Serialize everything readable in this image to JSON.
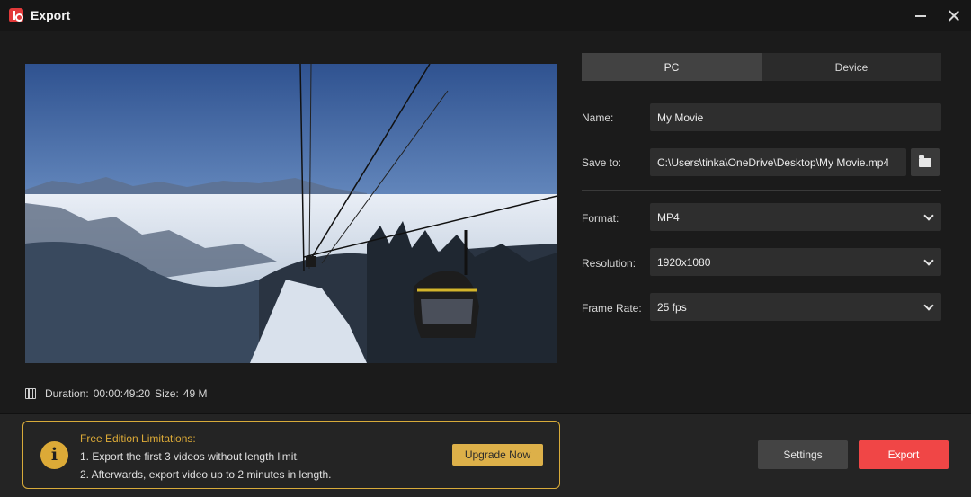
{
  "window": {
    "title": "Export",
    "minimize_icon": "minimize-icon",
    "close_icon": "close-icon"
  },
  "preview": {
    "image_description": "video preview thumbnail",
    "duration_label": "Duration:",
    "duration_value": "00:00:49:20",
    "size_label": "Size:",
    "size_value": "49 M"
  },
  "tabs": [
    {
      "label": "PC",
      "active": true
    },
    {
      "label": "Device",
      "active": false
    }
  ],
  "form": {
    "name_label": "Name:",
    "name_value": "My Movie",
    "save_to_label": "Save to:",
    "save_to_value": "C:\\Users\\tinka\\OneDrive\\Desktop\\My Movie.mp4",
    "format_label": "Format:",
    "format_value": "MP4",
    "resolution_label": "Resolution:",
    "resolution_value": "1920x1080",
    "frame_rate_label": "Frame Rate:",
    "frame_rate_value": "25 fps"
  },
  "limitations": {
    "title": "Free Edition Limitations:",
    "line1": "1. Export the first 3 videos without length limit.",
    "line2": "2. Afterwards, export video up to 2 minutes in length.",
    "upgrade_label": "Upgrade Now"
  },
  "actions": {
    "settings_label": "Settings",
    "export_label": "Export"
  },
  "colors": {
    "accent": "#f04646",
    "warning": "#dcaa37",
    "background": "#1b1b1b"
  }
}
